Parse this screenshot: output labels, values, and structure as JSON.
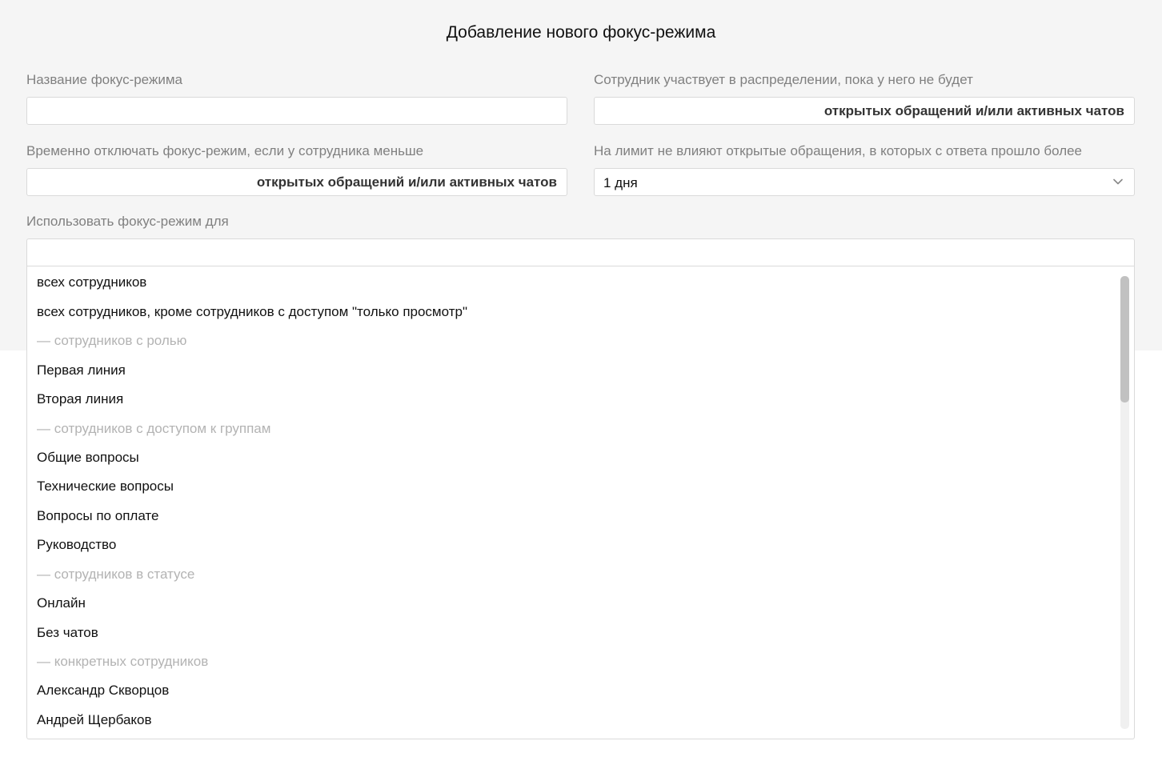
{
  "dialog": {
    "title": "Добавление нового фокус-режима"
  },
  "form": {
    "name": {
      "label": "Название фокус-режима",
      "value": ""
    },
    "participation": {
      "label": "Сотрудник участвует в распределении, пока у него не будет",
      "value": "",
      "suffix": "открытых обращений и/или активных чатов"
    },
    "disable_when": {
      "label": "Временно отключать фокус-режим, если у сотрудника меньше",
      "value": "",
      "suffix": "открытых обращений и/или активных чатов"
    },
    "limit_exclusion": {
      "label": "На лимит не влияют открытые обращения, в которых с ответа прошло более",
      "selected": "1 дня",
      "icon": "chevron-down-icon"
    },
    "use_for": {
      "label": "Использовать фокус-режим для",
      "value": ""
    }
  },
  "dropdown": {
    "options": [
      {
        "label": "всех сотрудников",
        "type": "option"
      },
      {
        "label": "всех сотрудников, кроме сотрудников с доступом \"только просмотр\"",
        "type": "option"
      },
      {
        "label": "— сотрудников с ролью",
        "type": "group"
      },
      {
        "label": "Первая линия",
        "type": "option"
      },
      {
        "label": "Вторая линия",
        "type": "option"
      },
      {
        "label": "— сотрудников с доступом к группам",
        "type": "group"
      },
      {
        "label": "Общие вопросы",
        "type": "option"
      },
      {
        "label": "Технические вопросы",
        "type": "option"
      },
      {
        "label": "Вопросы по оплате",
        "type": "option"
      },
      {
        "label": "Руководство",
        "type": "option"
      },
      {
        "label": "— сотрудников в статусе",
        "type": "group"
      },
      {
        "label": "Онлайн",
        "type": "option"
      },
      {
        "label": "Без чатов",
        "type": "option"
      },
      {
        "label": "— конкретных сотрудников",
        "type": "group"
      },
      {
        "label": "Александр Скворцов",
        "type": "option"
      },
      {
        "label": "Андрей Щербаков",
        "type": "option"
      }
    ]
  },
  "colors": {
    "panel_bg": "#f5f5f5",
    "label": "#808080",
    "group_header": "#b3b3b3",
    "border": "#dadada"
  }
}
